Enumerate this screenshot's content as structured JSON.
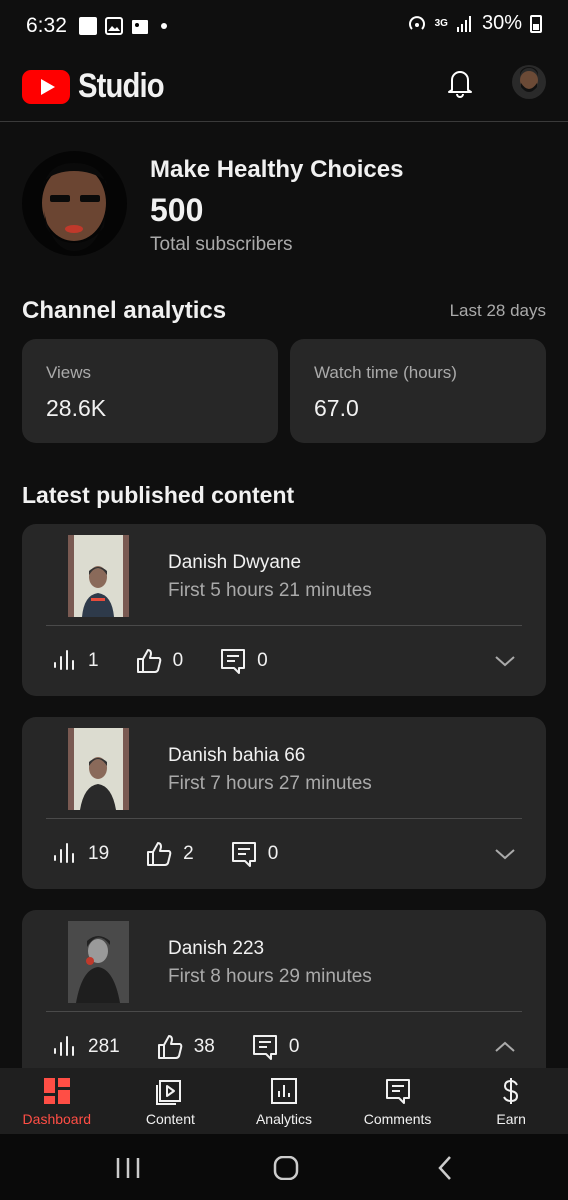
{
  "status_bar": {
    "time": "6:32",
    "network": "3G",
    "battery": "30%"
  },
  "header": {
    "brand": "Studio",
    "icons": [
      "youtube-logo",
      "bell-icon",
      "account-avatar"
    ]
  },
  "channel": {
    "name": "Make Healthy Choices",
    "subscriber_count": "500",
    "subscriber_label": "Total subscribers"
  },
  "analytics": {
    "title": "Channel analytics",
    "period": "Last 28 days",
    "cards": [
      {
        "label": "Views",
        "value": "28.6K"
      },
      {
        "label": "Watch time (hours)",
        "value": "67.0"
      }
    ]
  },
  "latest": {
    "title": "Latest published content",
    "videos": [
      {
        "title": "Danish Dwyane",
        "subtitle": "First 5 hours 21 minutes",
        "views": "1",
        "likes": "0",
        "comments": "0",
        "expanded": false
      },
      {
        "title": "Danish bahia 66",
        "subtitle": "First 7 hours 27 minutes",
        "views": "19",
        "likes": "2",
        "comments": "0",
        "expanded": false
      },
      {
        "title": "Danish 223",
        "subtitle": "First 8 hours 29 minutes",
        "views": "281",
        "likes": "38",
        "comments": "0",
        "expanded": true
      }
    ]
  },
  "bottom_nav": {
    "items": [
      {
        "label": "Dashboard",
        "icon": "dashboard-icon",
        "active": true
      },
      {
        "label": "Content",
        "icon": "content-icon",
        "active": false
      },
      {
        "label": "Analytics",
        "icon": "analytics-icon",
        "active": false
      },
      {
        "label": "Comments",
        "icon": "comments-icon",
        "active": false
      },
      {
        "label": "Earn",
        "icon": "earn-icon",
        "active": false
      }
    ]
  },
  "colors": {
    "accent": "#ff0000",
    "active_nav": "#ff4e45",
    "card_bg": "#272727",
    "page_bg": "#0f0f0f"
  }
}
